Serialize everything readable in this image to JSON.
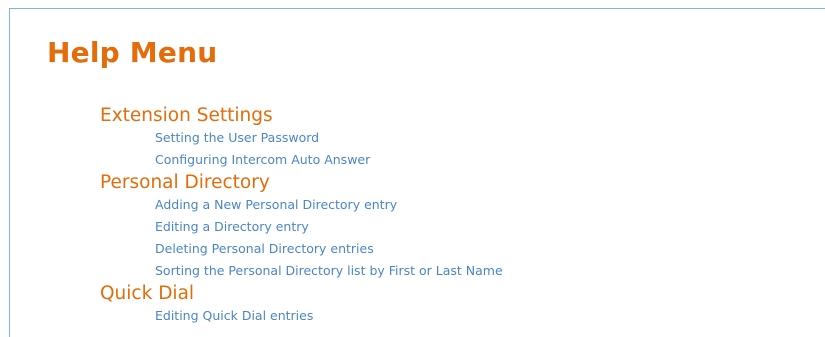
{
  "page": {
    "title": "Help Menu"
  },
  "sections": [
    {
      "heading": "Extension Settings",
      "links": [
        "Setting the User Password",
        "Configuring Intercom Auto Answer"
      ]
    },
    {
      "heading": "Personal Directory",
      "links": [
        "Adding a New Personal Directory entry",
        "Editing a Directory entry",
        "Deleting Personal Directory entries",
        "Sorting the Personal Directory list by First or Last Name"
      ]
    },
    {
      "heading": "Quick Dial",
      "links": [
        "Editing Quick Dial entries"
      ]
    }
  ],
  "colors": {
    "heading": "#e46c0a",
    "link": "#4a86c6",
    "frame_border": "#7fb3e3"
  }
}
